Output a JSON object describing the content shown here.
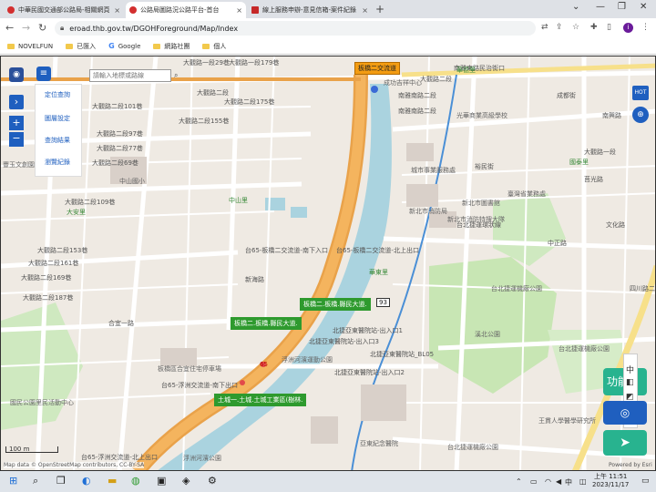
{
  "browser": {
    "tabs": [
      {
        "label": "中華民國交通部公路局-相關網頁",
        "color": "#d32f2f",
        "active": false
      },
      {
        "label": "公路局圖路況公路平台-首台",
        "color": "#d32f2f",
        "active": true
      },
      {
        "label": "線上服務申辦-意見信箱-案件紀錄",
        "color": "#c62828",
        "active": false
      }
    ],
    "url": "eroad.thb.gov.tw/DGOHForeground/Map/Index",
    "bookmarks": [
      "NOVELFUN",
      "已匯入",
      "Google",
      "網路社團",
      "個人"
    ],
    "profile_initial": "i"
  },
  "map_ui": {
    "search_placeholder": "請輸入地標或路線",
    "side_menu": [
      "定位查詢",
      "圖層設定",
      "查詢結果",
      "瀏覽紀錄"
    ],
    "hot_label": "HOT",
    "function_label": "功能",
    "scale_label": "100 m",
    "attribution": "Map data © OpenStreetMap contributors, CC-BY-SA",
    "powered": "Powered by Esri",
    "tools": [
      "中",
      "◧",
      "◩",
      "⚙"
    ]
  },
  "map_labels": {
    "streets": [
      "大觀路一段29巷",
      "大觀路一段179巷",
      "南雅東路民治街口",
      "大觀路二段",
      "大觀路二段175巷",
      "大觀路二段155巷",
      "大觀路二段101巷",
      "大觀路二段97巷",
      "大觀路二段77巷",
      "大觀路二段69巷",
      "大觀路二段109巷",
      "大觀路二段153巷",
      "大觀路二段161巷",
      "大觀路二段169巷",
      "大觀路二段187巷",
      "合宜一路",
      "台65-浮洲交流道-南下出口",
      "台65-浮洲交流道-北上出口",
      "大觀路二段",
      "南雅南路二段",
      "南雅南路二段",
      "成都街",
      "文化路",
      "台65-板橋二交流道-南下入口",
      "台65-板橋二交流道-北上出口",
      "台北捷運環狀線",
      "中正路",
      "四川路二段",
      "南興路",
      "北捷亞東醫院站-出入口1",
      "北捷亞東醫院站-出入口3",
      "北捷亞東醫院站_BL05",
      "北捷亞東醫院站-出入口2",
      "新海路",
      "裕民街",
      "大觀路一段",
      "莒光路"
    ],
    "areas": [
      "中山里",
      "大安里",
      "華東里",
      "國泰里",
      "華德里"
    ],
    "pois": [
      "成功吉祥中心",
      "光華商業高級學校",
      "城市事業服務處",
      "新北市圖書館",
      "新北市消防局",
      "新北市消防特搜大隊",
      "臺灣省業務處",
      "台北捷運機廠公園",
      "浮洲河濱運動公園",
      "板橋區合宜住宅停車場",
      "亞東紀念醫院",
      "台北捷運機廠公園",
      "王貫人學醫學研究所",
      "中山國小",
      "豐玉文創園區",
      "溪北公園",
      "國民公園里民活動中心",
      "浮洲河濱公園",
      "台北捷運機廠公園"
    ],
    "green_tags": [
      "板橋二.板橋.縣民大道.",
      "板橋二.板橋.縣民大道.",
      "土城一.土城.土城工業區(樹林."
    ],
    "orange_tag": "板橋二交流道",
    "route_shield": "65",
    "badge_93": "93"
  },
  "taskbar": {
    "time": "上午 11:51",
    "date": "2023/11/17",
    "ime": "中"
  }
}
